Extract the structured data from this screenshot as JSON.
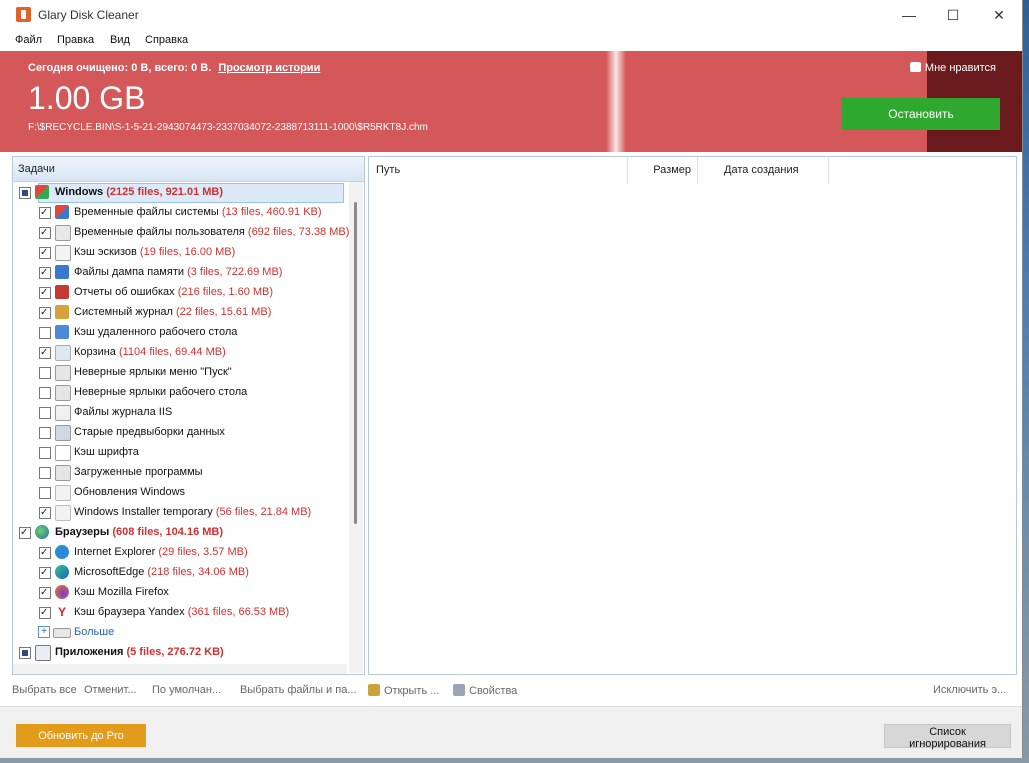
{
  "window": {
    "title": "Glary Disk Cleaner",
    "controls": {
      "minimize": "—",
      "maximize": "☐",
      "close": "✕"
    }
  },
  "menu": [
    "Файл",
    "Правка",
    "Вид",
    "Справка"
  ],
  "banner": {
    "summary": "Сегодня очищено: 0 B, всего: 0 B.",
    "history_link": "Просмотр истории",
    "scanned_size": "1.00 GB",
    "current_path": "F:\\$RECYCLE.BIN\\S-1-5-21-2943074473-2337034072-2388713111-1000\\$R5RKT8J.chm",
    "like_label": "Мне нравится",
    "stop_label": "Остановить",
    "colors": {
      "banner": "#d4585a",
      "stop_button": "#2ea82e"
    }
  },
  "tasks": {
    "header": "Задачи",
    "rows": [
      {
        "label": "Windows",
        "stats": "(2125 files, 921.01 MB)"
      },
      {
        "label": "Временные файлы системы",
        "stats": "(13 files, 460.91 KB)"
      },
      {
        "label": "Временные файлы пользователя",
        "stats": "(692 files, 73.38 MB)"
      },
      {
        "label": "Кэш эскизов",
        "stats": "(19 files, 16.00 MB)"
      },
      {
        "label": "Файлы дампа памяти",
        "stats": "(3 files, 722.69 MB)"
      },
      {
        "label": "Отчеты об ошибках",
        "stats": "(216 files, 1.60 MB)"
      },
      {
        "label": "Системный журнал",
        "stats": "(22 files, 15.61 MB)"
      },
      {
        "label": "Кэш удаленного рабочего стола",
        "stats": ""
      },
      {
        "label": "Корзина",
        "stats": "(1104 files, 69.44 MB)"
      },
      {
        "label": "Неверные ярлыки меню \"Пуск\"",
        "stats": ""
      },
      {
        "label": "Неверные ярлыки рабочего стола",
        "stats": ""
      },
      {
        "label": "Файлы журнала IIS",
        "stats": ""
      },
      {
        "label": "Старые предвыборки данных",
        "stats": ""
      },
      {
        "label": "Кэш шрифта",
        "stats": ""
      },
      {
        "label": "Загруженные программы",
        "stats": ""
      },
      {
        "label": "Обновления Windows",
        "stats": ""
      },
      {
        "label": "Windows Installer temporary",
        "stats": "(56 files, 21.84 MB)"
      },
      {
        "label": "Браузеры",
        "stats": "(608 files, 104.16 MB)"
      },
      {
        "label": "Internet Explorer",
        "stats": "(29 files, 3.57 MB)"
      },
      {
        "label": "MicrosoftEdge",
        "stats": "(218 files, 34.06 MB)"
      },
      {
        "label": "Кэш Mozilla Firefox",
        "stats": ""
      },
      {
        "label": "Кэш браузера Yandex",
        "stats": "(361 files, 66.53 MB)"
      },
      {
        "label": "Больше",
        "stats": ""
      },
      {
        "label": "Приложения",
        "stats": "(5 files, 276.72 KB)"
      }
    ]
  },
  "results": {
    "columns": [
      "Путь",
      "Размер",
      "Дата создания"
    ]
  },
  "toolbar": {
    "select_all": "Выбрать все",
    "deselect": "Отменит...",
    "default": "По умолчан...",
    "select_files": "Выбрать файлы и па...",
    "open": "Открыть ...",
    "properties": "Свойства",
    "exclude": "Исключить э..."
  },
  "footer": {
    "upgrade": "Обновить до Pro",
    "ignore_list": "Список игнорирования"
  }
}
